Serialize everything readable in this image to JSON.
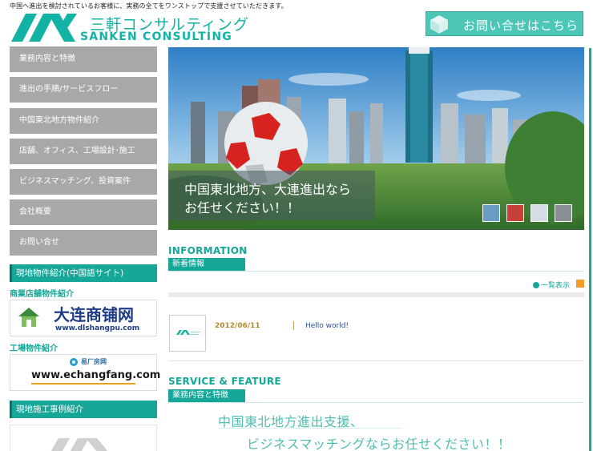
{
  "header": {
    "tagline": "中国へ進出を検討されているお客様に、実務の全てをワンストップで支援させていただきます。",
    "logo_jp": "三軒コンサルティング",
    "logo_en": "SANKEN CONSULTING",
    "contact_label": "お問い合せはこちら"
  },
  "nav": {
    "items": [
      {
        "label": "業務内容と特徴"
      },
      {
        "label": "進出の手順/サービスフロー"
      },
      {
        "label": "中国東北地方物件紹介"
      },
      {
        "label": "店舗、オフィス、工場設計･施工"
      },
      {
        "label": "ビジネスマッチング、投資案件"
      },
      {
        "label": "会社概要"
      },
      {
        "label": "お問い合せ"
      }
    ]
  },
  "sidebar": {
    "local_heading": "現地物件紹介(中国語サイト)",
    "shop_label": "商業店舗物件紹介",
    "shop_banner": {
      "title": "大连商铺网",
      "url": "www.dlshangpu.com"
    },
    "factory_label": "工場物件紹介",
    "factory_banner": {
      "title": "易厂房网",
      "url": "www.echangfang.com"
    },
    "construction_heading": "現地施工事例紹介"
  },
  "hero": {
    "line1": "中国東北地方、大連進出なら",
    "line2": "お任せください！！"
  },
  "information": {
    "title": "INFORMATION",
    "subtitle": "新着情報",
    "list_link": "一覧表示",
    "items": [
      {
        "date": "2012/06/11",
        "title": "Hello world!"
      }
    ]
  },
  "service": {
    "title": "SERVICE & FEATURE",
    "subtitle": "業務内容と特徴",
    "slogan_line1": "中国東北地方進出支援、",
    "slogan_line2": "ビジネスマッチングならお任せください！！"
  },
  "colors": {
    "accent": "#16a798",
    "nav_bg": "#a8a8a8",
    "date": "#b58a2b",
    "link": "#2b4f9b"
  }
}
